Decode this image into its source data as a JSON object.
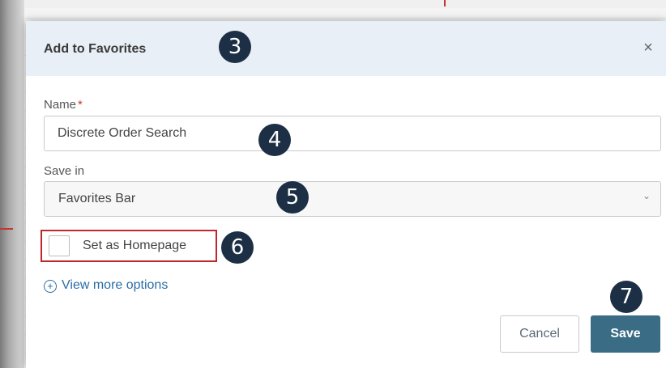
{
  "dialog": {
    "title": "Add to Favorites",
    "close_glyph": "×"
  },
  "name_field": {
    "label": "Name",
    "required_marker": "*",
    "value": "Discrete Order Search"
  },
  "save_in_field": {
    "label": "Save in",
    "selected": "Favorites Bar",
    "chevron_glyph": "⌄"
  },
  "homepage": {
    "label": "Set as Homepage",
    "checked": false
  },
  "more_options": {
    "icon_glyph": "+",
    "label": "View more options"
  },
  "actions": {
    "cancel_label": "Cancel",
    "save_label": "Save"
  },
  "step_badges": [
    "3",
    "4",
    "5",
    "6",
    "7"
  ],
  "colors": {
    "header_bg": "#e8eff6",
    "accent_link": "#2a6ea6",
    "save_button": "#3a6c86",
    "highlight_border": "#c0272d",
    "badge": "#1c2f45"
  }
}
